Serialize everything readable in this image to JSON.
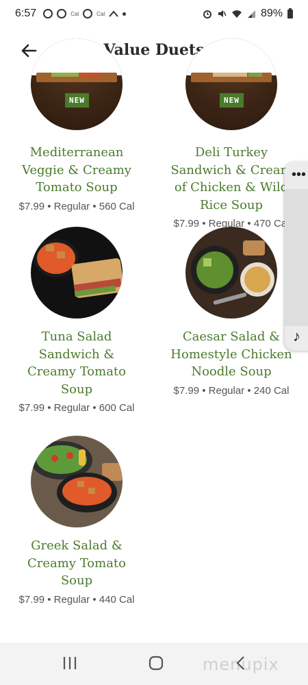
{
  "status_bar": {
    "time": "6:57",
    "notif_small_1": "Cal",
    "notif_small_2": "Cal",
    "battery": "89%"
  },
  "header": {
    "title": "Value Duets"
  },
  "items": [
    {
      "name": "Mediterranean Veggie & Creamy Tomato Soup",
      "meta": "$7.99 • Regular • 560 Cal",
      "badge": "NEW"
    },
    {
      "name": "Deli Turkey Sandwich & Cream of Chicken & Wild Rice Soup",
      "meta": "$7.99 • Regular • 470 Cal",
      "badge": "NEW"
    },
    {
      "name": "Tuna Salad Sandwich & Creamy Tomato Soup",
      "meta": "$7.99 • Regular • 600 Cal"
    },
    {
      "name": "Caesar Salad & Homestyle Chicken Noodle Soup",
      "meta": "$7.99 • Regular • 240 Cal"
    },
    {
      "name": "Greek Salad & Creamy Tomato Soup",
      "meta": "$7.99 • Regular • 440 Cal"
    }
  ],
  "side_panel": {
    "dots": "•••",
    "music": "♪"
  },
  "watermark": "menupix",
  "icons": [
    "back-arrow-icon",
    "recent-apps-icon",
    "home-icon",
    "back-nav-icon",
    "alarm-icon",
    "mute-icon",
    "wifi-icon",
    "signal-icon",
    "battery-icon",
    "more-icon",
    "music-note-icon"
  ]
}
